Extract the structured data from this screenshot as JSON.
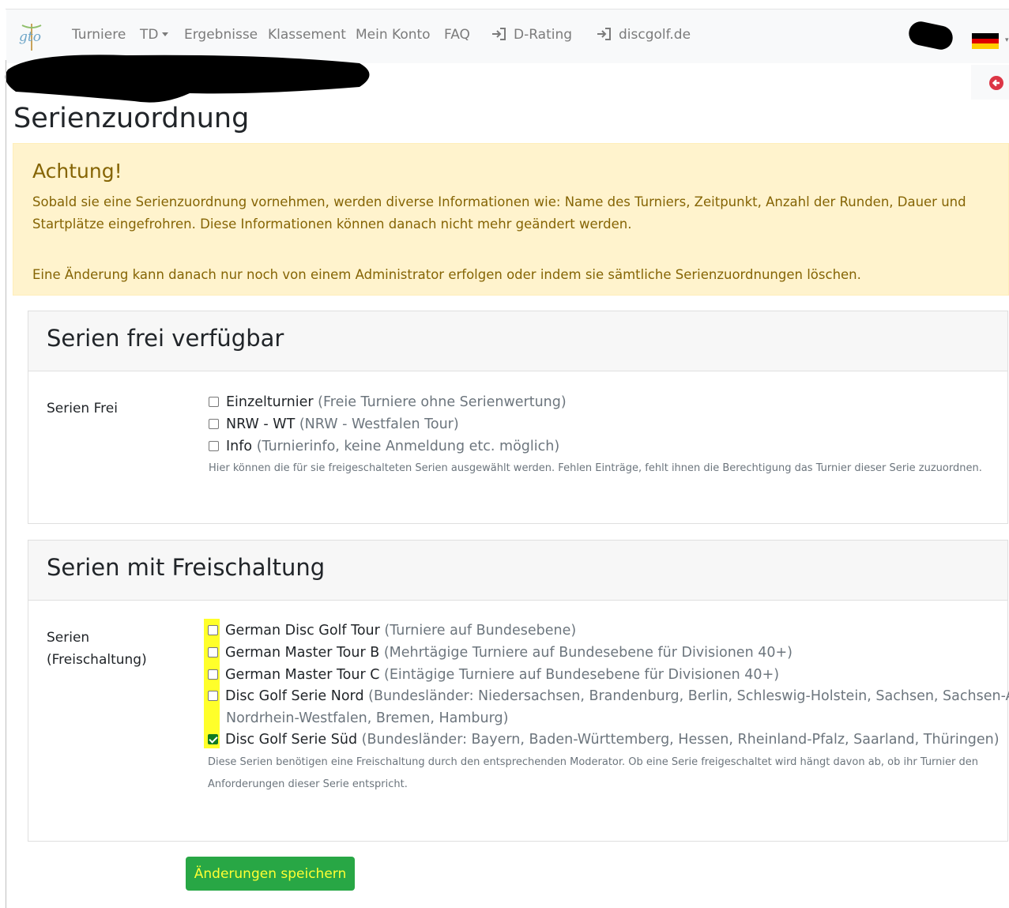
{
  "navbar": {
    "items": [
      {
        "label": "Turniere"
      },
      {
        "label": "TD"
      },
      {
        "label": "Ergebnisse"
      },
      {
        "label": "Klassement"
      },
      {
        "label": "Mein Konto"
      },
      {
        "label": "FAQ"
      },
      {
        "label": "D-Rating",
        "icon": "sign-in-icon"
      },
      {
        "label": "discgolf.de",
        "icon": "sign-in-icon"
      }
    ],
    "logo_text": "gto",
    "language_flag": "de-flag",
    "logout_icon": "logout-icon",
    "accent": "#dc3545"
  },
  "page": {
    "title": "Serienzuordnung"
  },
  "alert": {
    "heading": "Achtung!",
    "text1": "Sobald sie eine Serienzuordnung vornehmen, werden diverse Informationen wie: Name des Turniers, Zeitpunkt, Anzahl der Runden, Dauer und Startplätze eingefrohren. Diese Informationen können danach nicht mehr geändert werden.",
    "text2": "Eine Änderung kann danach nur noch von einem Administrator erfolgen oder indem sie sämtliche Serienzuordnungen löschen.",
    "bg_color": "#fff3cd",
    "text_color": "#856404"
  },
  "free_series": {
    "title": "Serien frei verfügbar",
    "label": "Serien Frei",
    "options": [
      {
        "name": "Einzelturnier",
        "desc": "(Freie Turniere ohne Serienwertung)",
        "checked": false
      },
      {
        "name": "NRW - WT",
        "desc": "(NRW - Westfalen Tour)",
        "checked": false
      },
      {
        "name": "Info",
        "desc": "(Turnierinfo, keine Anmeldung etc. möglich)",
        "checked": false
      }
    ],
    "help": "Hier können die für sie freigeschalteten Serien ausgewählt werden. Fehlen Einträge, fehlt ihnen die Berechtigung das Turnier dieser Serie zuzuordnen."
  },
  "locked_series": {
    "title": "Serien mit Freischaltung",
    "label_line1": "Serien",
    "label_line2": "(Freischaltung)",
    "options": [
      {
        "name": "German Disc Golf Tour",
        "desc": "(Turniere auf Bundesebene)",
        "checked": false
      },
      {
        "name": "German Master Tour B",
        "desc": "(Mehrtägige Turniere auf Bundesebene für Divisionen 40+)",
        "checked": false
      },
      {
        "name": "German Master Tour C",
        "desc": "(Eintägige Turniere auf Bundesebene für Divisionen 40+)",
        "checked": false
      },
      {
        "name": "Disc Golf Serie Nord",
        "desc": "(Bundesländer: Niedersachsen, Brandenburg, Berlin, Schleswig-Holstein, Sachsen, Sachsen-Anhalt,",
        "desc_cont": "Nordrhein-Westfalen, Bremen, Hamburg)",
        "checked": false
      },
      {
        "name": "Disc Golf Serie Süd",
        "desc": "(Bundesländer: Bayern, Baden-Württemberg, Hessen, Rheinland-Pfalz, Saarland, Thüringen)",
        "checked": true
      }
    ],
    "help_line1": "Diese Serien benötigen eine Freischaltung durch den entsprechenden Moderator. Ob eine Serie freigeschaltet wird hängt davon ab, ob ihr Turnier den",
    "help_line2": "Anforderungen dieser Serie entspricht."
  },
  "save_button": {
    "label": "Änderungen speichern",
    "color": "#28a745"
  }
}
